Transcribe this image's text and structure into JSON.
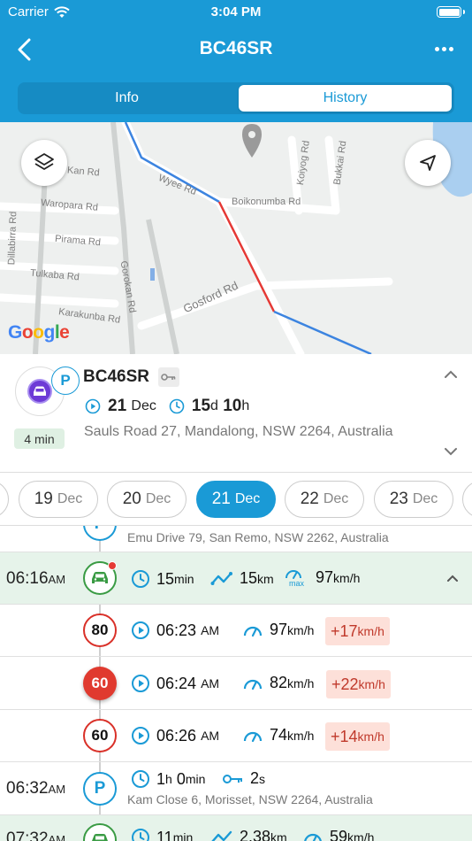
{
  "status": {
    "carrier": "Carrier",
    "time": "3:04 PM"
  },
  "nav": {
    "title": "BC46SR"
  },
  "tabs": [
    {
      "label": "Info"
    },
    {
      "label": "History",
      "selected": true
    }
  ],
  "map": {
    "street_labels": [
      "Wyee Rd",
      "Boikonumba Rd",
      "Koiyog Rd",
      "Bukkai Rd",
      "Gosford Rd",
      "Gorokan Rd",
      "Waropara Rd",
      "Pirama Rd",
      "Tulkaba Rd",
      "Karakunba Rd",
      "Dillabirra Rd",
      "Kan Rd"
    ],
    "logo": "Google"
  },
  "vehicle": {
    "plate": "BC46SR",
    "status_badge": "P",
    "duration_pill": "4 min",
    "start_day": "21",
    "start_month": "Dec",
    "elapsed_days": "15",
    "elapsed_days_unit": "d",
    "elapsed_hours": "10",
    "elapsed_hours_unit": "h",
    "address": "Sauls Road 27, Mandalong, NSW 2264, Australia"
  },
  "dates": [
    {
      "day": "19",
      "month": "Dec"
    },
    {
      "day": "20",
      "month": "Dec"
    },
    {
      "day": "21",
      "month": "Dec",
      "active": true
    },
    {
      "day": "22",
      "month": "Dec"
    },
    {
      "day": "23",
      "month": "Dec"
    }
  ],
  "timeline": {
    "top_partial_address": "Emu Drive 79, San Remo, NSW 2262, Australia",
    "trip1": {
      "time": "06:16",
      "ampm": "AM",
      "duration_val": "15",
      "duration_unit": "min",
      "distance_val": "15",
      "distance_unit": "km",
      "max_label": "max",
      "max_speed_val": "97",
      "max_speed_unit": "km/h"
    },
    "speeding": [
      {
        "limit": "80",
        "time": "06:23",
        "ampm": "AM",
        "speed": "97",
        "speed_unit": "km/h",
        "over": "+17",
        "over_unit": "km/h",
        "highlight": false
      },
      {
        "limit": "60",
        "time": "06:24",
        "ampm": "AM",
        "speed": "82",
        "speed_unit": "km/h",
        "over": "+22",
        "over_unit": "km/h",
        "highlight": true
      },
      {
        "limit": "60",
        "time": "06:26",
        "ampm": "AM",
        "speed": "74",
        "speed_unit": "km/h",
        "over": "+14",
        "over_unit": "km/h",
        "highlight": false
      }
    ],
    "stop": {
      "time": "06:32",
      "ampm": "AM",
      "badge": "P",
      "dur_h": "1",
      "dur_h_unit": "h",
      "dur_min": "0",
      "dur_min_unit": "min",
      "key_val": "2",
      "key_unit": "s",
      "address": "Kam Close 6, Morisset, NSW 2264, Australia"
    },
    "trip2": {
      "time": "07:32",
      "ampm": "AM",
      "duration_val": "11",
      "duration_unit": "min",
      "distance_val": "2.38",
      "distance_unit": "km",
      "max_speed_val": "59",
      "max_speed_unit": "km/h"
    }
  },
  "colors": {
    "brand": "#1a9ad6",
    "trip_bg": "#e6f3ea",
    "speeding": "#e03a2f",
    "over_bg": "#fde0d9"
  }
}
